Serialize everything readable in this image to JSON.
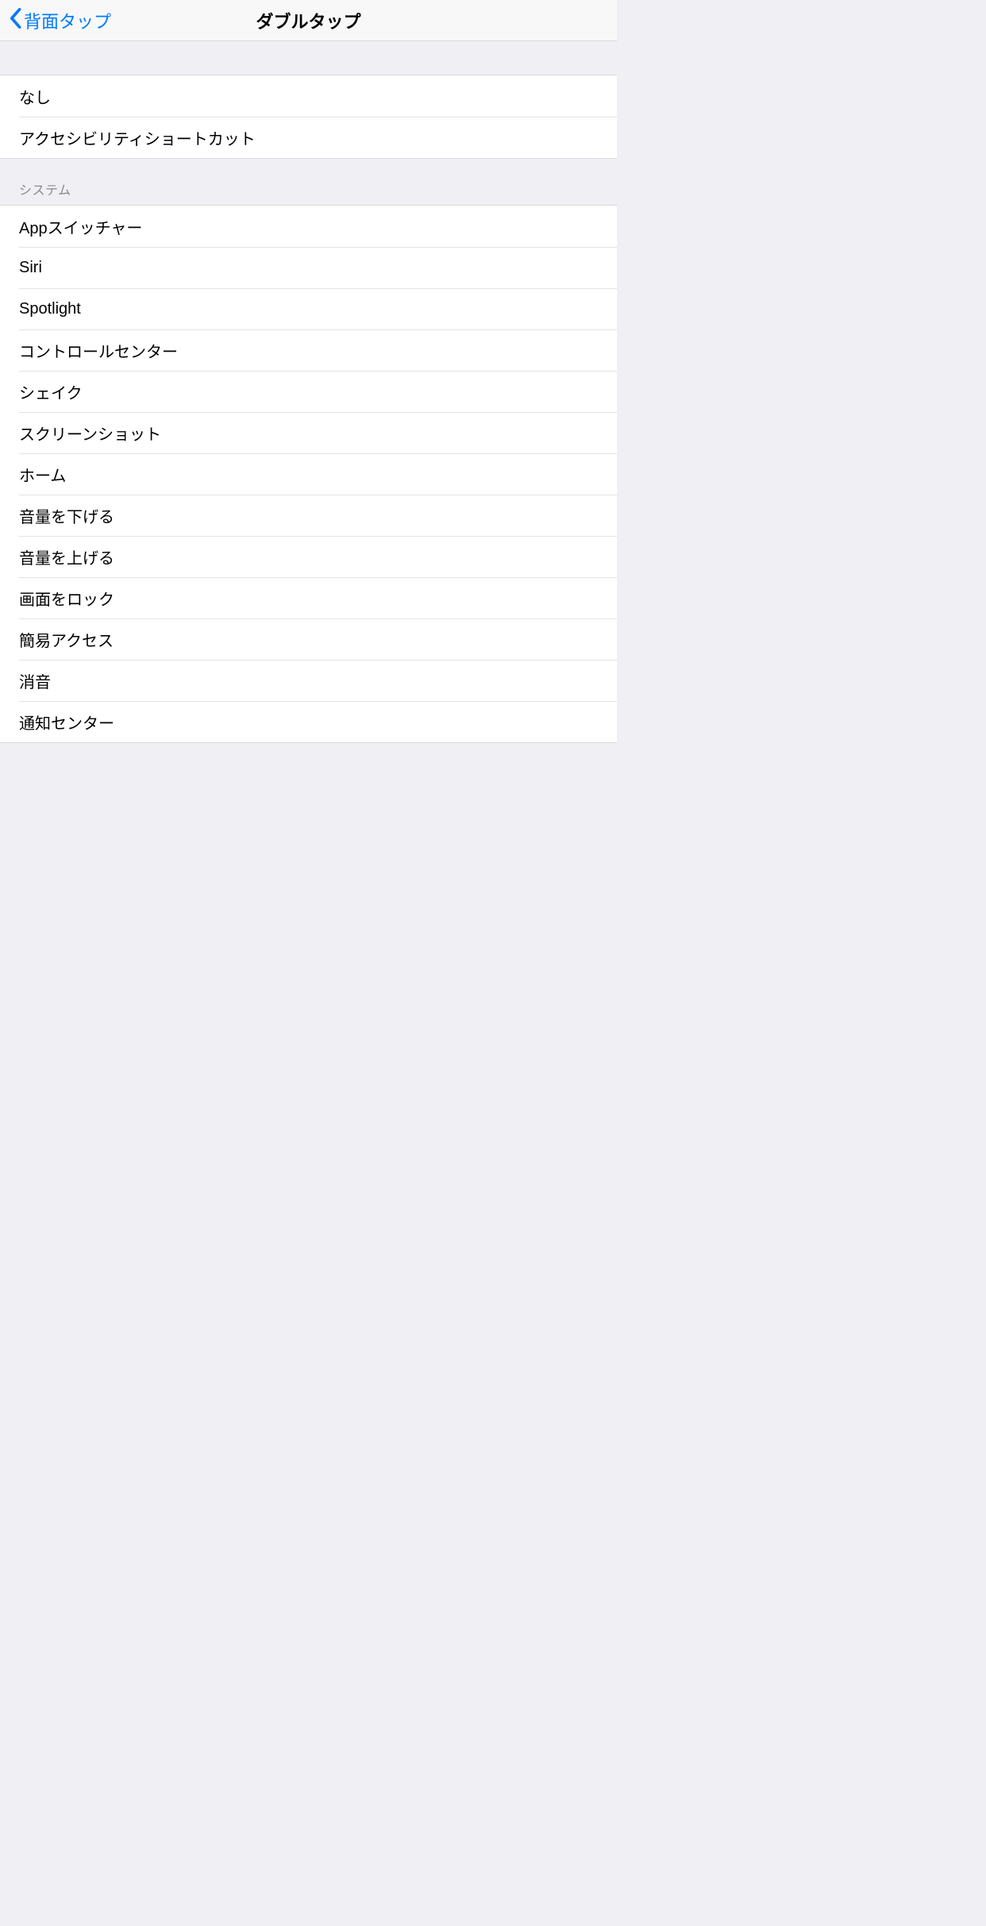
{
  "nav": {
    "back": "背面タップ",
    "title": "ダブルタップ"
  },
  "groups": [
    {
      "header": null,
      "items": [
        "なし",
        "アクセシビリティショートカット"
      ]
    },
    {
      "header": "システム",
      "items": [
        "Appスイッチャー",
        "Siri",
        "Spotlight",
        "コントロールセンター",
        "シェイク",
        "スクリーンショット",
        "ホーム",
        "音量を下げる",
        "音量を上げる",
        "画面をロック",
        "簡易アクセス",
        "消音",
        "通知センター"
      ]
    }
  ]
}
